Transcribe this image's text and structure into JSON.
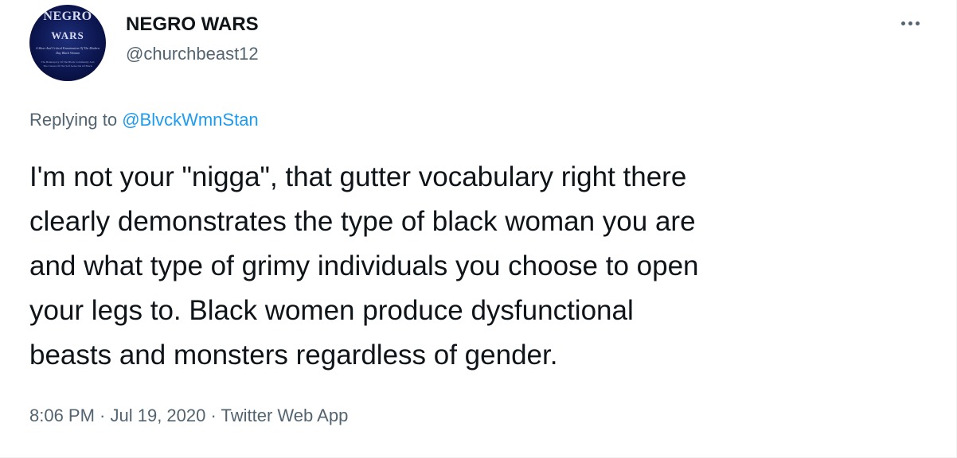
{
  "author": {
    "display_name": "NEGRO WARS",
    "handle": "@churchbeast12",
    "avatar": {
      "line1": "NEGRO",
      "line2": "WARS",
      "subtitle": "A Short And Critical Examination Of The Modern Day Black Woman",
      "tiny": "The Bankruptcy Of The Black Community And The Causes Of The Self Genocide Of Black"
    }
  },
  "reply": {
    "prefix": "Replying to ",
    "mention": "@BlvckWmnStan"
  },
  "tweet": {
    "text_lines": [
      "I'm not your \"nigga\", that gutter vocabulary right there",
      "clearly demonstrates the type of black woman you are",
      "and what type of grimy individuals you choose to open",
      "your legs to. Black women produce dysfunctional",
      "beasts and monsters regardless of gender."
    ]
  },
  "meta": {
    "time": "8:06 PM",
    "separator1": " · ",
    "date": "Jul 19, 2020",
    "separator2": " · ",
    "source": "Twitter Web App"
  },
  "icons": {
    "more": "more-horizontal-icon"
  },
  "colors": {
    "link": "#1d9bf0",
    "secondary_text": "#536471",
    "primary_text": "#0f1419"
  }
}
